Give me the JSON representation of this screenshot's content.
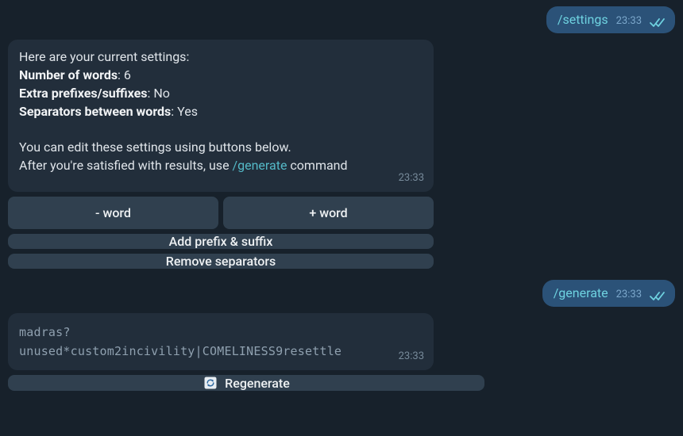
{
  "messages": {
    "settings_cmd": {
      "text": "/settings",
      "time": "23:33"
    },
    "settings_reply": {
      "intro": "Here are your current settings:",
      "lines": [
        {
          "label": "Number of words",
          "value": ": 6"
        },
        {
          "label": "Extra prefixes/suffixes",
          "value": ": No"
        },
        {
          "label": "Separators between words",
          "value": ": Yes"
        }
      ],
      "edit_line": "You can edit these settings using buttons below.",
      "after_line_pre": "After you're satisfied with results, use ",
      "after_line_link": "/generate",
      "after_line_post": " command",
      "time": "23:33"
    },
    "settings_buttons": {
      "minus": "- word",
      "plus": "+ word",
      "prefix": "Add prefix & suffix",
      "separators": "Remove separators"
    },
    "generate_cmd": {
      "text": "/generate",
      "time": "23:33"
    },
    "generate_reply": {
      "password": "madras?unused*custom2incivility|COMELINESS9resettle",
      "time": "23:33"
    },
    "generate_buttons": {
      "regenerate": "Regenerate"
    }
  }
}
